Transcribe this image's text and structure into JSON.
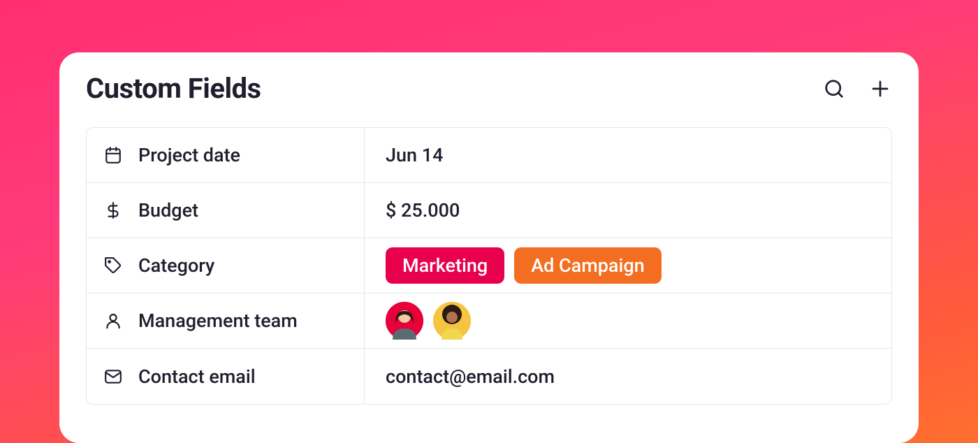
{
  "header": {
    "title": "Custom Fields"
  },
  "fields": [
    {
      "icon": "calendar",
      "label": "Project date",
      "type": "text",
      "value": "Jun 14"
    },
    {
      "icon": "dollar",
      "label": "Budget",
      "type": "text",
      "value": "$ 25.000"
    },
    {
      "icon": "tag",
      "label": "Category",
      "type": "tags",
      "tags": [
        {
          "text": "Marketing",
          "color": "pink"
        },
        {
          "text": "Ad Campaign",
          "color": "orange"
        }
      ]
    },
    {
      "icon": "person",
      "label": "Management team",
      "type": "avatars",
      "avatars": [
        {
          "bg": "#e8003a"
        },
        {
          "bg": "#f5c542"
        }
      ]
    },
    {
      "icon": "mail",
      "label": "Contact email",
      "type": "text",
      "value": "contact@email.com"
    }
  ],
  "colors": {
    "tag_pink": "#e8004c",
    "tag_orange": "#f36e21"
  }
}
